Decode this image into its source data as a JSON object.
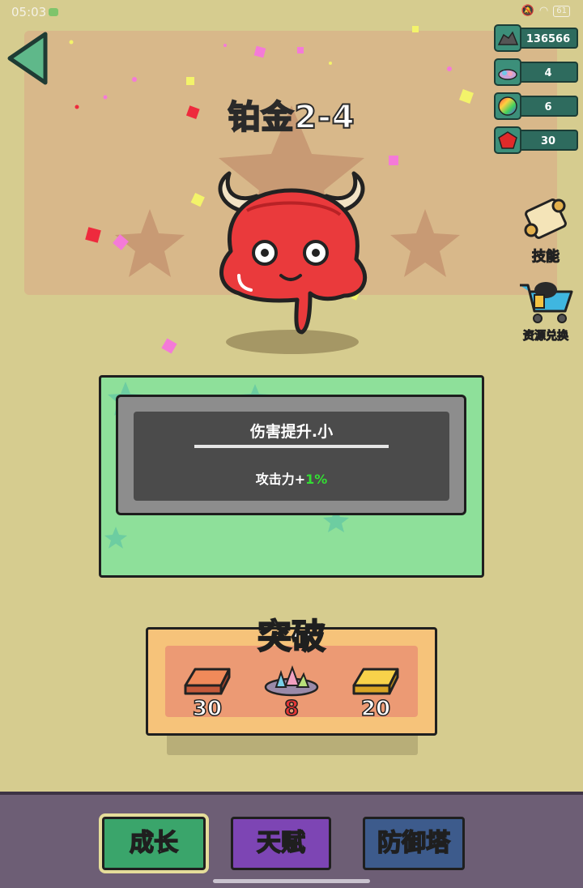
{
  "status_bar": {
    "time": "05:03",
    "battery": "61"
  },
  "level": {
    "title": "铂金2-4"
  },
  "resources": [
    {
      "icon": "rock-pile-icon",
      "value": "136566"
    },
    {
      "icon": "gem-pile-icon",
      "value": "4"
    },
    {
      "icon": "rainbow-orb-icon",
      "value": "6"
    },
    {
      "icon": "red-gem-icon",
      "value": "30"
    }
  ],
  "side_buttons": {
    "skills": {
      "icon": "scroll-icon",
      "label": "技能"
    },
    "exchange": {
      "icon": "shopping-cart-icon",
      "label": "资源兑换"
    }
  },
  "talent_card": {
    "name": "伤害提升.小",
    "desc_prefix": "攻击力+",
    "desc_value": "1%",
    "value_color": "#33dd33"
  },
  "breakthrough": {
    "title": "突破",
    "materials": [
      {
        "icon": "copper-ingot-icon",
        "count": "30",
        "sufficient": true
      },
      {
        "icon": "crystal-pile-icon",
        "count": "8",
        "sufficient": false
      },
      {
        "icon": "gold-ingot-icon",
        "count": "20",
        "sufficient": true
      }
    ]
  },
  "nav_tabs": {
    "growth": "成长",
    "talent": "天赋",
    "tower": "防御塔"
  },
  "colors": {
    "background": "#d6cc8f",
    "card_green": "#8ee09a",
    "nav_bg": "#6d5e75",
    "monster_red": "#ea3a3c"
  }
}
